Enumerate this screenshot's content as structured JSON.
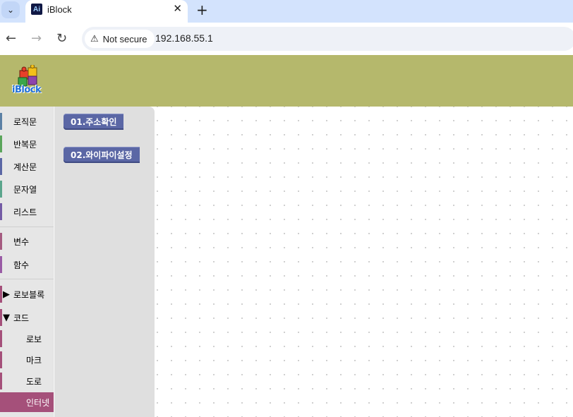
{
  "browser": {
    "tab_title": "iBlock",
    "favicon_text": "Ai",
    "security_label": "Not secure",
    "url": "192.168.55.1"
  },
  "app": {
    "logo_text": "iBlock"
  },
  "toolbox": {
    "categories": [
      {
        "label": "로직문",
        "color": "#5b80a5"
      },
      {
        "label": "반복문",
        "color": "#5ba55b"
      },
      {
        "label": "계산문",
        "color": "#5b67a5"
      },
      {
        "label": "문자열",
        "color": "#5ba58c"
      },
      {
        "label": "리스트",
        "color": "#745ba5"
      },
      {
        "label": "변수",
        "color": "#a55b80"
      },
      {
        "label": "함수",
        "color": "#995ba5"
      },
      {
        "label": "로보블록",
        "color": "#a5507a",
        "arrow": "▶"
      },
      {
        "label": "코드",
        "color": "#a5507a",
        "arrow": "▼"
      },
      {
        "label": "로보",
        "color": "#a5507a"
      },
      {
        "label": "마크",
        "color": "#a5507a"
      },
      {
        "label": "도로",
        "color": "#a5507a"
      },
      {
        "label": "인터넷",
        "color": "#a5507a"
      }
    ]
  },
  "flyout": {
    "blocks": [
      {
        "label": "01.주소확인"
      },
      {
        "label": "02.와이파이설정"
      }
    ]
  }
}
